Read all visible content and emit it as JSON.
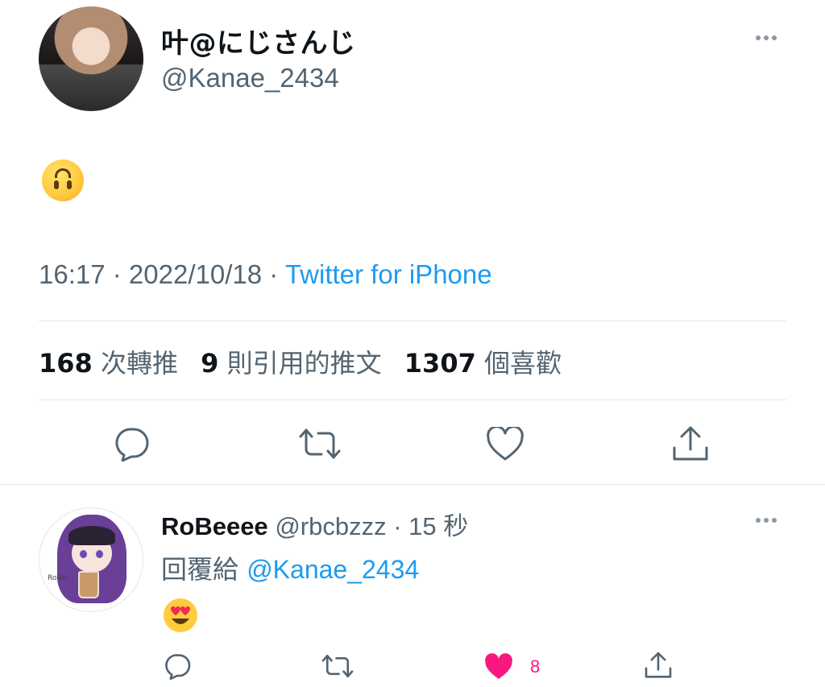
{
  "tweet": {
    "display_name": "叶@にじさんじ",
    "handle": "@Kanae_2434",
    "content_emoji": "upside-down-face",
    "time": "16:17",
    "date": "2022/10/18",
    "separator": " · ",
    "source": "Twitter for iPhone",
    "stats": {
      "retweets_count": "168",
      "retweets_label": "次轉推",
      "quotes_count": "9",
      "quotes_label": "則引用的推文",
      "likes_count": "1307",
      "likes_label": "個喜歡"
    }
  },
  "reply": {
    "display_name": "RoBeeee",
    "handle": "@rbcbzzz",
    "time_ago": "15 秒",
    "replying_label": "回覆給",
    "replying_to": "@Kanae_2434",
    "content_emoji": "smiling-face-with-heart-eyes",
    "like_count": "8",
    "liked": true,
    "avatar_tag": "RoBe…"
  },
  "colors": {
    "text_primary": "#0f1419",
    "text_secondary": "#536471",
    "accent": "#1d9bf0",
    "like": "#f91880",
    "divider": "#e1e6ea"
  },
  "icons": [
    "reply-icon",
    "retweet-icon",
    "like-icon",
    "share-icon",
    "more-icon"
  ]
}
